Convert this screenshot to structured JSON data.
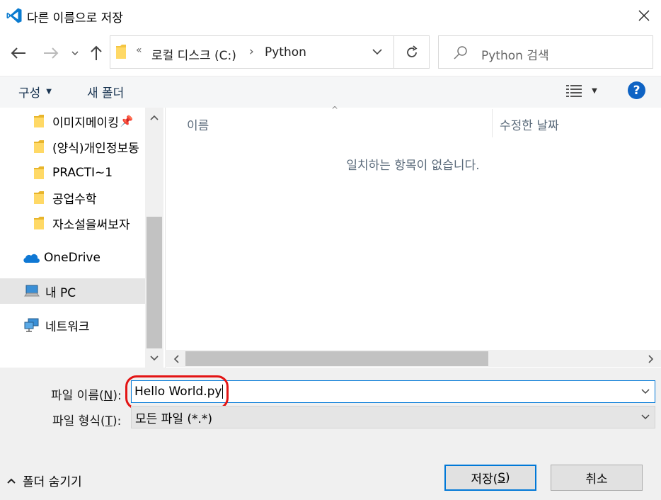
{
  "window": {
    "title": "다른 이름으로 저장"
  },
  "nav": {
    "breadcrumb_overflow": "«",
    "breadcrumbs": [
      "로컬 디스크 (C:)",
      "Python"
    ],
    "search_placeholder": "Python 검색"
  },
  "toolbar": {
    "organize_label": "구성",
    "new_folder_label": "새 폴더",
    "help_label": "?"
  },
  "sidebar": {
    "items": [
      {
        "label": "이미지메이킹",
        "icon": "folder-icon",
        "pinned": true
      },
      {
        "label": "(양식)개인정보동",
        "icon": "folder-icon"
      },
      {
        "label": "PRACTI~1",
        "icon": "folder-icon"
      },
      {
        "label": "공업수학",
        "icon": "folder-icon"
      },
      {
        "label": "자소설을써보자",
        "icon": "folder-icon"
      },
      {
        "label": "OneDrive",
        "icon": "onedrive-icon"
      },
      {
        "label": "내 PC",
        "icon": "pc-icon",
        "selected": true
      },
      {
        "label": "네트워크",
        "icon": "network-icon"
      }
    ]
  },
  "content": {
    "columns": [
      "이름",
      "수정한 날짜"
    ],
    "empty_message": "일치하는 항목이 없습니다."
  },
  "form": {
    "filename_label_prefix": "파일 이름(",
    "filename_label_key": "N",
    "filename_label_suffix": "):",
    "filename_value": "Hello World.py",
    "filetype_label_prefix": "파일 형식(",
    "filetype_label_key": "T",
    "filetype_label_suffix": "):",
    "filetype_value": "모든 파일 (*.*)"
  },
  "buttons": {
    "save_prefix": "저장(",
    "save_key": "S",
    "save_suffix": ")",
    "cancel": "취소",
    "hide_folders": "폴더 숨기기"
  },
  "colors": {
    "accent": "#0078d7",
    "annotation": "#e31414",
    "folder": "#f4c542"
  }
}
